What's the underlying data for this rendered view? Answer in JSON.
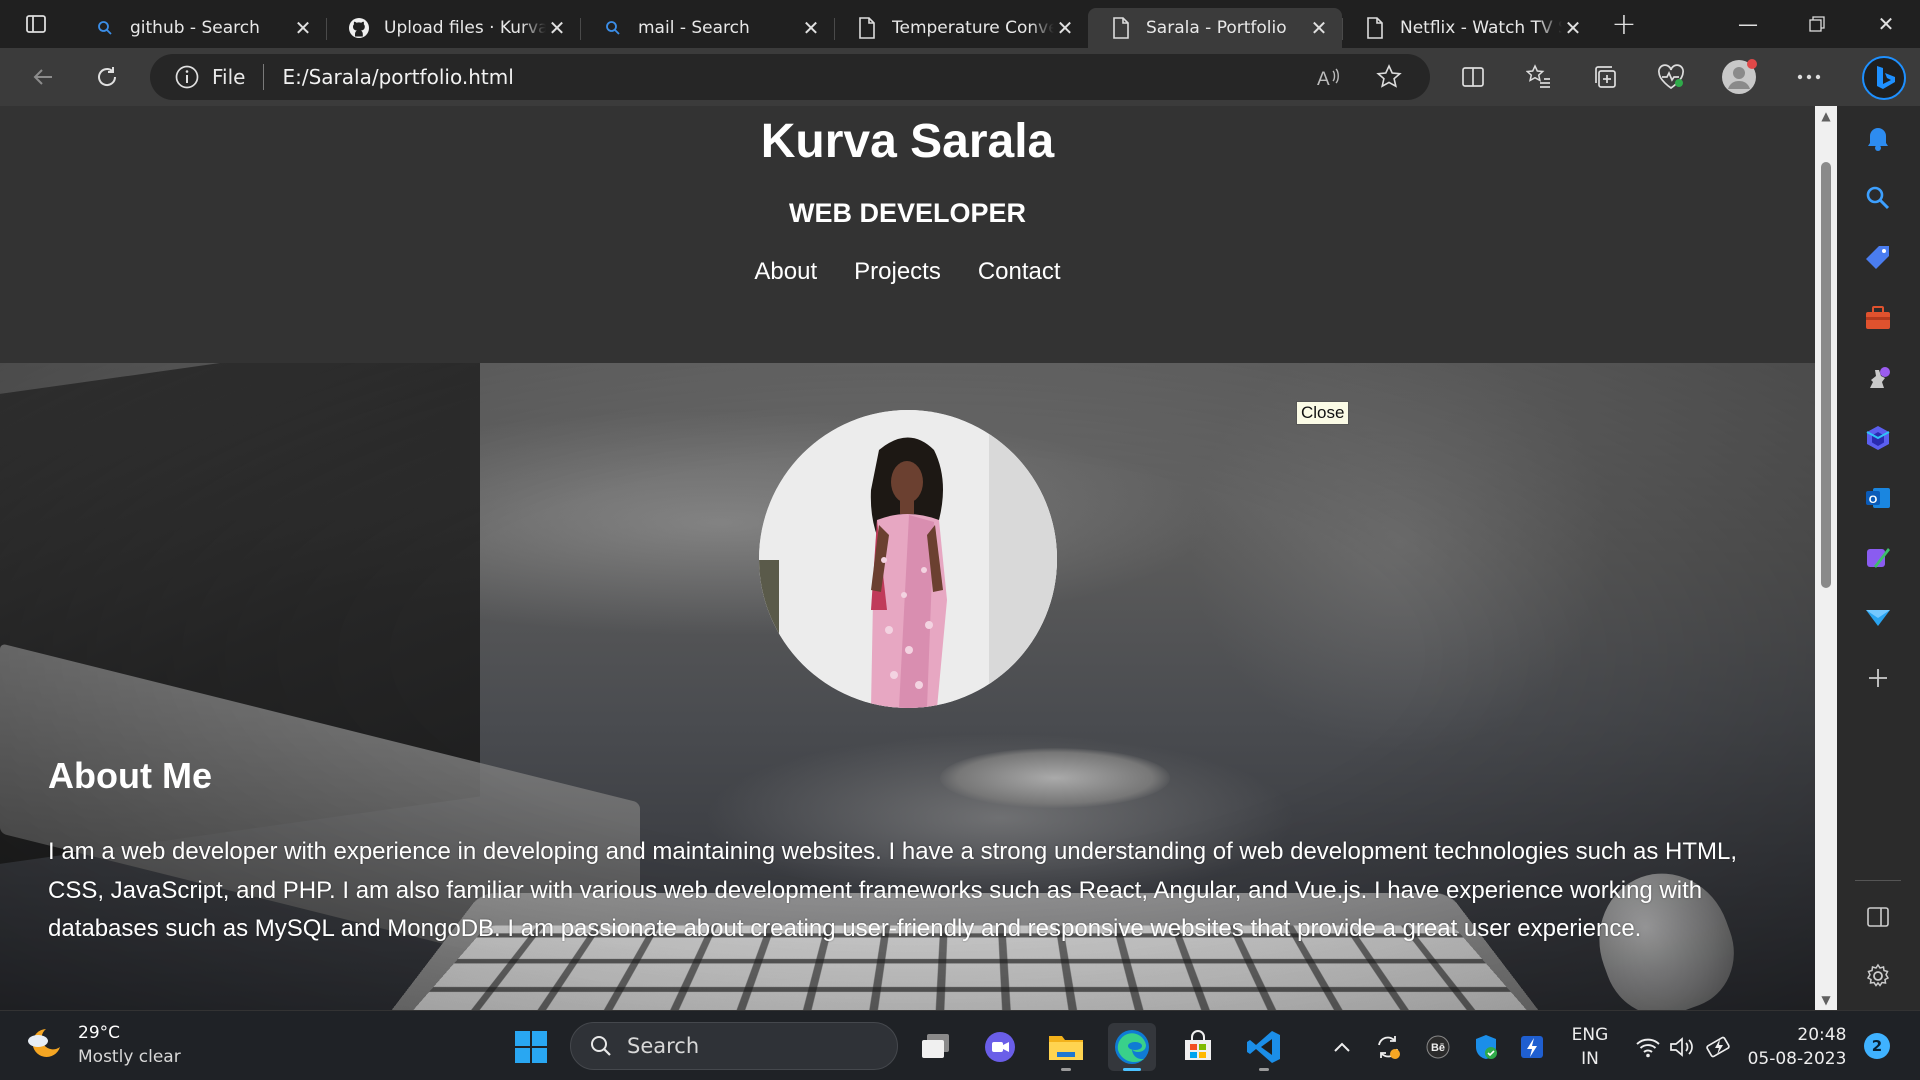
{
  "browser": {
    "tabs": [
      {
        "title": "github - Search",
        "icon": "search-icon"
      },
      {
        "title": "Upload files · Kurvas",
        "icon": "github-icon"
      },
      {
        "title": "mail - Search",
        "icon": "search-icon"
      },
      {
        "title": "Temperature Converter",
        "icon": "page-icon"
      },
      {
        "title": "Sarala - Portfolio",
        "icon": "page-icon",
        "active": true
      },
      {
        "title": "Netflix - Watch TV Shows",
        "icon": "page-icon"
      }
    ],
    "address": {
      "scheme_label": "File",
      "url": "E:/Sarala/portfolio.html"
    }
  },
  "page": {
    "header": {
      "name": "Kurva Sarala",
      "role": "WEB DEVELOPER"
    },
    "nav": [
      "About",
      "Projects",
      "Contact"
    ],
    "tooltip": "Close",
    "about": {
      "title": "About Me",
      "text": "I am a web developer with experience in developing and maintaining websites. I have a strong understanding of web development technologies such as HTML, CSS, JavaScript, and PHP. I am also familiar with various web development frameworks such as React, Angular, and Vue.js. I have experience working with databases such as MySQL and MongoDB. I am passionate about creating user-friendly and responsive websites that provide a great user experience."
    }
  },
  "taskbar": {
    "weather": {
      "temp": "29°C",
      "desc": "Mostly clear"
    },
    "search_label": "Search",
    "lang": {
      "line1": "ENG",
      "line2": "IN"
    },
    "clock": {
      "time": "20:48",
      "date": "05-08-2023"
    },
    "notification_count": "2"
  },
  "colors": {
    "page_header_bg": "#333333",
    "edge_accent": "#1e90ff",
    "taskbar_bg": "#1f2226"
  }
}
